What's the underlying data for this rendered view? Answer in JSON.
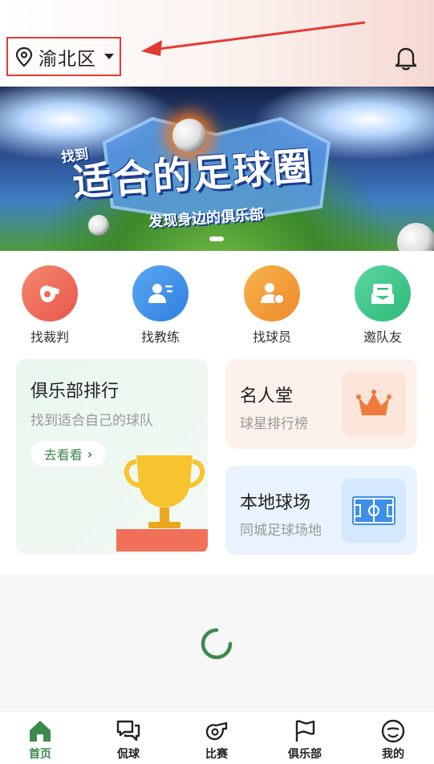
{
  "header": {
    "location": "渝北区",
    "icons": [
      "location-pin-icon",
      "caret-down-icon",
      "bell-icon"
    ]
  },
  "banner": {
    "small_title": "找到",
    "big_title": "适合的足球圈",
    "subtitle": "发现身边的俱乐部"
  },
  "quick_actions": [
    {
      "label": "找裁判",
      "icon": "whistle-icon",
      "color": "#ef6a5a"
    },
    {
      "label": "找教练",
      "icon": "coach-icon",
      "color": "#3d8fe8"
    },
    {
      "label": "找球员",
      "icon": "player-icon",
      "color": "#f29a3a"
    },
    {
      "label": "邀队友",
      "icon": "invite-icon",
      "color": "#3cc28a"
    }
  ],
  "cards": {
    "club_rank": {
      "title": "俱乐部排行",
      "subtitle": "找到适合自己的球队",
      "button": "去看看"
    },
    "hall_of_fame": {
      "title": "名人堂",
      "subtitle": "球星排行榜"
    },
    "local_fields": {
      "title": "本地球场",
      "subtitle": "同城足球场地"
    }
  },
  "tabs": [
    {
      "label": "首页",
      "icon": "home-icon",
      "active": true
    },
    {
      "label": "侃球",
      "icon": "chat-icon",
      "active": false
    },
    {
      "label": "比赛",
      "icon": "whistle-icon",
      "active": false
    },
    {
      "label": "俱乐部",
      "icon": "flag-icon",
      "active": false
    },
    {
      "label": "我的",
      "icon": "profile-icon",
      "active": false
    }
  ],
  "colors": {
    "brand_green": "#3c8a4e",
    "highlight_red": "#e53935"
  }
}
